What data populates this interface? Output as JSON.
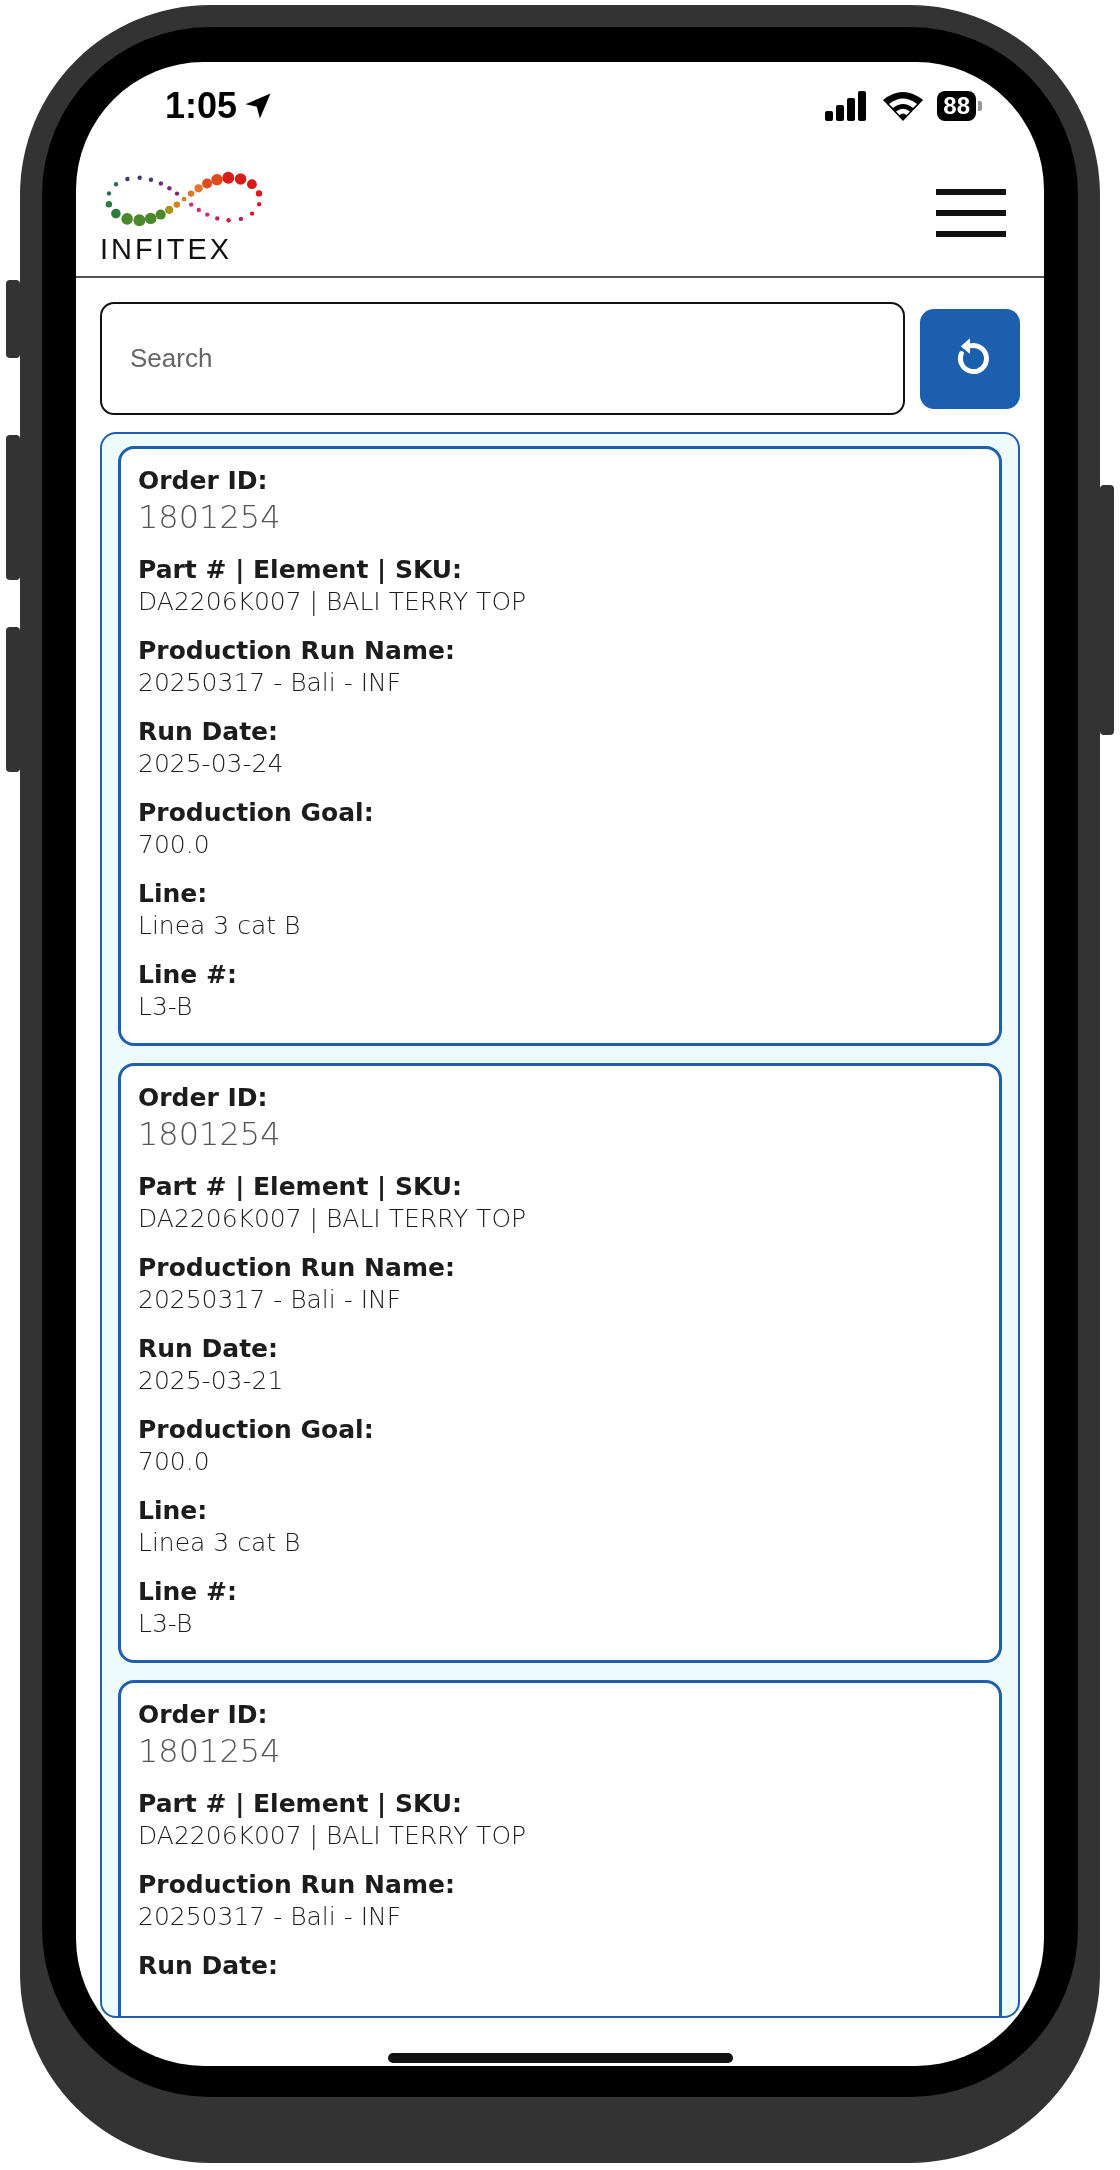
{
  "status_bar": {
    "time": "1:05",
    "battery": "88"
  },
  "header": {
    "logo_text": "INFITEX"
  },
  "search": {
    "placeholder": "Search"
  },
  "orders": [
    {
      "fields": [
        {
          "kind": "id",
          "label": "Order ID:",
          "value": "1801254"
        },
        {
          "kind": "text",
          "label": "Part # | Element | SKU:",
          "value": "DA2206K007 | BALI TERRY TOP"
        },
        {
          "kind": "text",
          "label": "Production Run Name:",
          "value": "20250317 - Bali - INF"
        },
        {
          "kind": "text",
          "label": "Run Date:",
          "value": "2025-03-24"
        },
        {
          "kind": "text",
          "label": "Production Goal:",
          "value": "700.0"
        },
        {
          "kind": "text",
          "label": "Line:",
          "value": "Linea 3 cat B"
        },
        {
          "kind": "text",
          "label": "Line #:",
          "value": "L3-B"
        }
      ]
    },
    {
      "fields": [
        {
          "kind": "id",
          "label": "Order ID:",
          "value": "1801254"
        },
        {
          "kind": "text",
          "label": "Part # | Element | SKU:",
          "value": "DA2206K007 | BALI TERRY TOP"
        },
        {
          "kind": "text",
          "label": "Production Run Name:",
          "value": "20250317 - Bali - INF"
        },
        {
          "kind": "text",
          "label": "Run Date:",
          "value": "2025-03-21"
        },
        {
          "kind": "text",
          "label": "Production Goal:",
          "value": "700.0"
        },
        {
          "kind": "text",
          "label": "Line:",
          "value": "Linea 3 cat B"
        },
        {
          "kind": "text",
          "label": "Line #:",
          "value": "L3-B"
        }
      ]
    },
    {
      "fields": [
        {
          "kind": "id",
          "label": "Order ID:",
          "value": "1801254"
        },
        {
          "kind": "text",
          "label": "Part # | Element | SKU:",
          "value": "DA2206K007 | BALI TERRY TOP"
        },
        {
          "kind": "text",
          "label": "Production Run Name:",
          "value": "20250317 - Bali - INF"
        },
        {
          "kind": "text",
          "label": "Run Date:"
        }
      ]
    }
  ]
}
